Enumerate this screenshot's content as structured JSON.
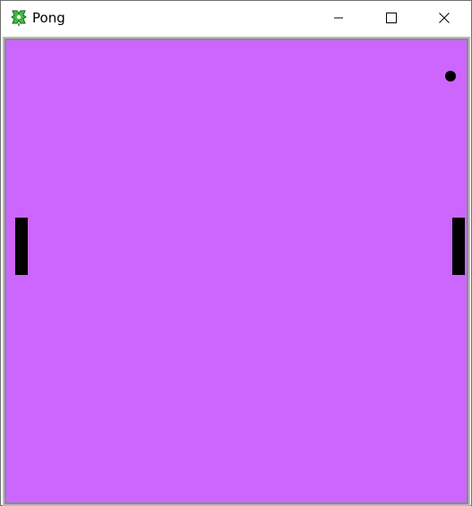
{
  "window": {
    "title": "Pong",
    "controls": {
      "minimize": "minimize-icon",
      "maximize": "maximize-icon",
      "close": "close-icon"
    }
  },
  "app": {
    "icon": "pong-app-icon",
    "icon_colors": [
      "#2d7d2d",
      "#3fbf3f",
      "#1f5f1f",
      "#ffffff"
    ]
  },
  "game": {
    "background_color": "#cc66ff",
    "paddle_color": "#000000",
    "ball_color": "#000000",
    "left_paddle": "left-paddle",
    "right_paddle": "right-paddle",
    "ball": "ball"
  }
}
